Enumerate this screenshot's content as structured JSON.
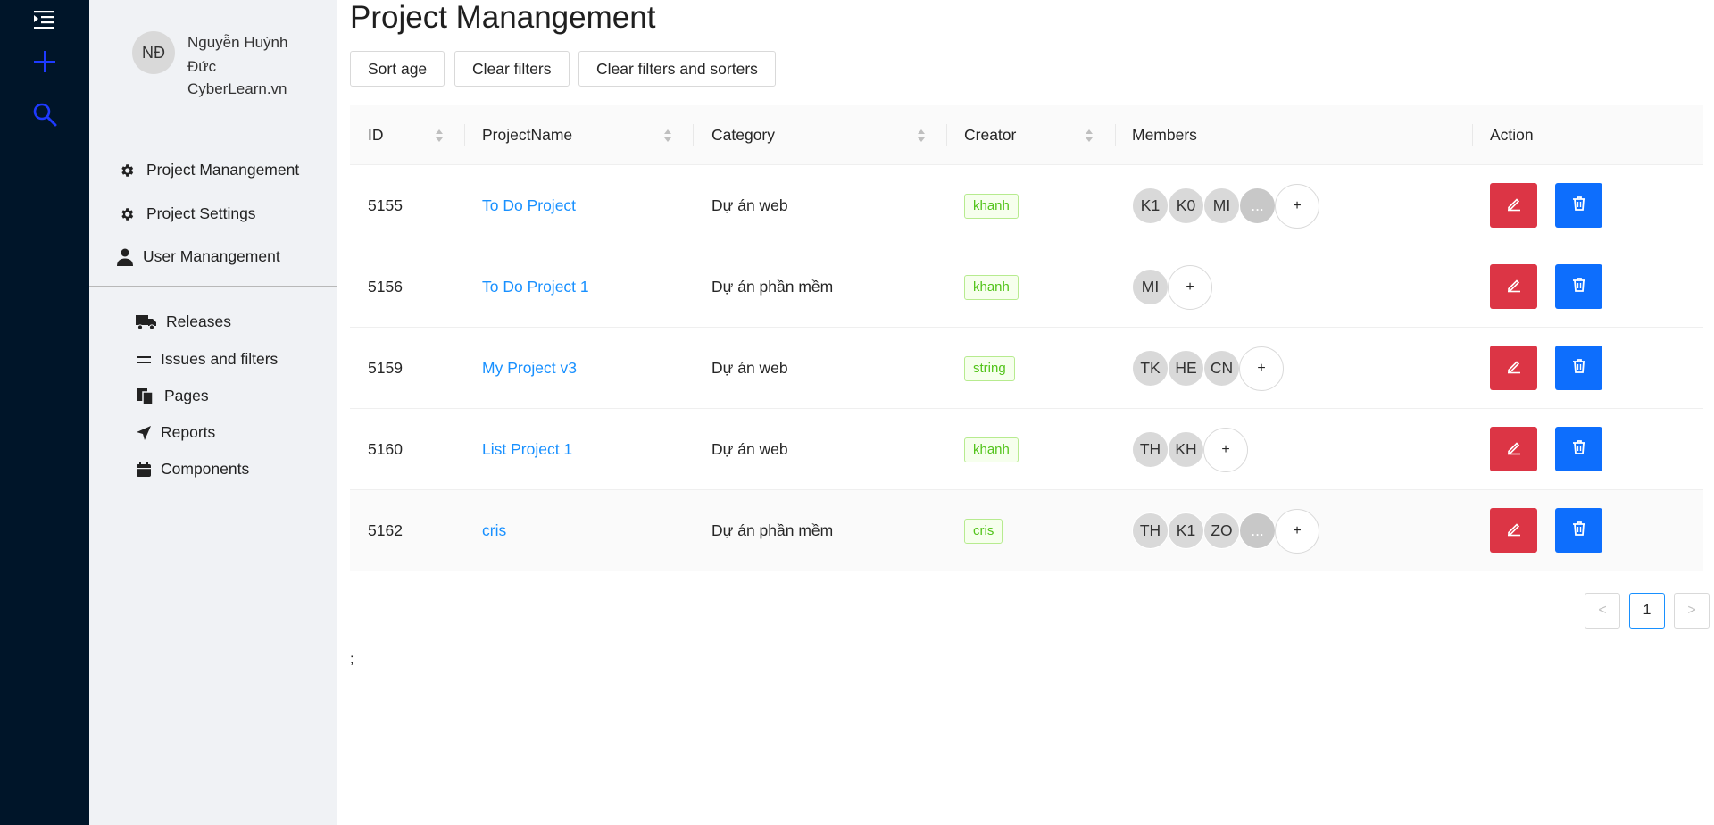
{
  "rail": {
    "icons": [
      "menu-indent-icon",
      "plus-icon",
      "search-icon"
    ],
    "icon_color": "#1e3aff"
  },
  "user": {
    "initials": "NĐ",
    "name": "Nguyễn Huỳnh Đức",
    "site": "CyberLearn.vn"
  },
  "menu": [
    {
      "label": "Project Manangement",
      "icon": "gear-icon"
    },
    {
      "label": "Project Settings",
      "icon": "gear-icon"
    },
    {
      "label": "User Manangement",
      "icon": "user-icon"
    }
  ],
  "submenu": [
    {
      "label": "Releases",
      "icon": "truck-icon"
    },
    {
      "label": "Issues and filters",
      "icon": "equals-icon"
    },
    {
      "label": "Pages",
      "icon": "copy-icon"
    },
    {
      "label": "Reports",
      "icon": "send-icon"
    },
    {
      "label": "Components",
      "icon": "calendar-icon"
    }
  ],
  "page_title": "Project Manangement",
  "toolbar": {
    "sort_age": "Sort age",
    "clear_filters": "Clear filters",
    "clear_filters_sorters": "Clear filters and sorters"
  },
  "columns": {
    "id": "ID",
    "name": "ProjectName",
    "category": "Category",
    "creator": "Creator",
    "members": "Members",
    "action": "Action"
  },
  "rows": [
    {
      "id": "5155",
      "name": "To Do Project",
      "category": "Dự án web",
      "creator": "khanh",
      "members": [
        "K1",
        "K0",
        "MI"
      ],
      "more": "..."
    },
    {
      "id": "5156",
      "name": "To Do Project 1",
      "category": "Dự án phần mềm",
      "creator": "khanh",
      "members": [
        "MI"
      ],
      "more": ""
    },
    {
      "id": "5159",
      "name": "My Project v3",
      "category": "Dự án web",
      "creator": "string",
      "members": [
        "TK",
        "HE",
        "CN"
      ],
      "more": ""
    },
    {
      "id": "5160",
      "name": "List Project 1",
      "category": "Dự án web",
      "creator": "khanh",
      "members": [
        "TH",
        "KH"
      ],
      "more": ""
    },
    {
      "id": "5162",
      "name": "cris",
      "category": "Dự án phần mềm",
      "creator": "cris",
      "members": [
        "TH",
        "K1",
        "ZO"
      ],
      "more": "..."
    }
  ],
  "add_member": "+",
  "pagination": {
    "prev": "<",
    "current": "1",
    "next": ">"
  },
  "stray_text": ";",
  "colors": {
    "rail": "#001529",
    "sidebar": "#f0f2f5",
    "edit": "#dc3545",
    "delete": "#0d6efd",
    "link": "#1890ff"
  }
}
